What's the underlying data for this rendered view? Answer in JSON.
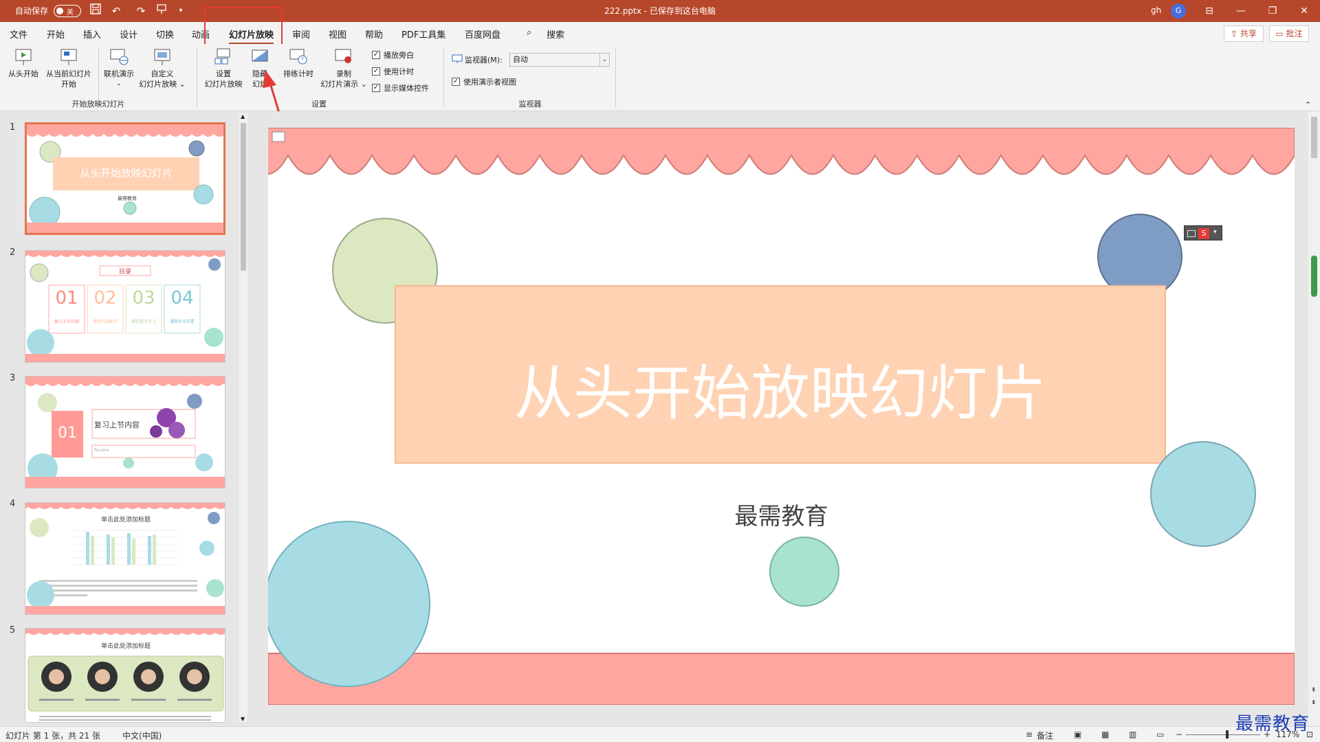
{
  "titlebar": {
    "autosave_label": "自动保存",
    "autosave_state": "关",
    "document": "222.pptx  -  已保存到这台电脑",
    "user": "gh",
    "avatar_letter": "G"
  },
  "tabs": [
    {
      "label": "文件"
    },
    {
      "label": "开始"
    },
    {
      "label": "插入"
    },
    {
      "label": "设计"
    },
    {
      "label": "切换"
    },
    {
      "label": "动画"
    },
    {
      "label": "幻灯片放映"
    },
    {
      "label": "审阅"
    },
    {
      "label": "视图"
    },
    {
      "label": "帮助"
    },
    {
      "label": "PDF工具集"
    },
    {
      "label": "百度网盘"
    }
  ],
  "search_label": "搜索",
  "share_label": "共享",
  "comment_label": "批注",
  "ribbon": {
    "from_start": "从头开始",
    "from_current_1": "从当前幻灯片",
    "from_current_2": "开始",
    "online": "联机演示",
    "custom_1": "自定义",
    "custom_2": "幻灯片放映",
    "group_start": "开始放映幻灯片",
    "setup_1": "设置",
    "setup_2": "幻灯片放映",
    "hide_1": "隐藏",
    "hide_2": "幻灯",
    "rehearse": "排练计时",
    "record_1": "录制",
    "record_2": "幻灯片演示",
    "chk_narration": "播放旁白",
    "chk_timing": "使用计时",
    "chk_media": "显示媒体控件",
    "group_setup": "设置",
    "monitor_label": "监视器(M):",
    "monitor_value": "自动",
    "chk_presenter": "使用演示者视图",
    "group_monitor": "监视器"
  },
  "thumbnails": [
    {
      "num": "1",
      "title": "从头开始放映幻灯片",
      "subtitle": "最需教育"
    },
    {
      "num": "2",
      "title": "目录",
      "items": [
        "01",
        "02",
        "03",
        "04"
      ],
      "captions": [
        "复习上节内容",
        "课程内容教学",
        "课程重点学习",
        "课程作业布置"
      ]
    },
    {
      "num": "3",
      "badge": "01",
      "title": "复习上节内容",
      "sub": "Review"
    },
    {
      "num": "4",
      "title": "单击此处添加标题"
    },
    {
      "num": "5",
      "title": "单击此处添加标题"
    }
  ],
  "slide": {
    "title": "从头开始放映幻灯片",
    "subtitle": "最需教育"
  },
  "status": {
    "slide_info": "幻灯片 第 1 张，共 21 张",
    "language": "中文(中国)",
    "notes": "备注",
    "zoom": "117%"
  },
  "watermark": "最需教育",
  "colors": {
    "accent": "#b7472a",
    "scallop": "#ffa6a0",
    "banner": "#ffd2b3",
    "green": "#dbe8c2",
    "blue": "#7f9dc4",
    "cyan": "#a8dce5",
    "mint": "#a7e3cd"
  }
}
